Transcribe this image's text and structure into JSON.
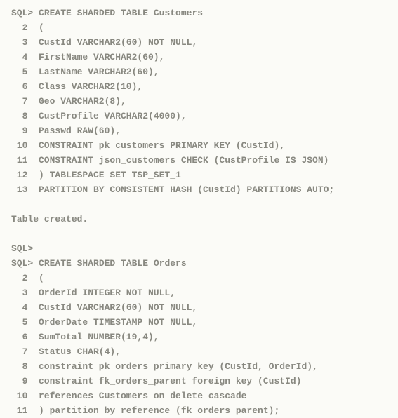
{
  "prompt": "SQL>",
  "block1": {
    "first": "CREATE SHARDED TABLE Customers",
    "lines": [
      "(",
      "CustId VARCHAR2(60) NOT NULL,",
      "FirstName VARCHAR2(60),",
      "LastName VARCHAR2(60),",
      "Class VARCHAR2(10),",
      "Geo VARCHAR2(8),",
      "CustProfile VARCHAR2(4000),",
      "Passwd RAW(60),",
      "CONSTRAINT pk_customers PRIMARY KEY (CustId),",
      "CONSTRAINT json_customers CHECK (CustProfile IS JSON)",
      ") TABLESPACE SET TSP_SET_1",
      "PARTITION BY CONSISTENT HASH (CustId) PARTITIONS AUTO;"
    ],
    "result": "Table created."
  },
  "block2": {
    "first": "CREATE SHARDED TABLE Orders",
    "lines": [
      "(",
      "OrderId INTEGER NOT NULL,",
      "CustId VARCHAR2(60) NOT NULL,",
      "OrderDate TIMESTAMP NOT NULL,",
      "SumTotal NUMBER(19,4),",
      "Status CHAR(4),",
      "constraint pk_orders primary key (CustId, OrderId),",
      "constraint fk_orders_parent foreign key (CustId)",
      "references Customers on delete cascade",
      ") partition by reference (fk_orders_parent);"
    ]
  },
  "linenums": [
    "2",
    "3",
    "4",
    "5",
    "6",
    "7",
    "8",
    "9",
    "10",
    "11",
    "12",
    "13"
  ],
  "linenums2": [
    "2",
    "3",
    "4",
    "5",
    "6",
    "7",
    "8",
    "9",
    "10",
    "11"
  ]
}
